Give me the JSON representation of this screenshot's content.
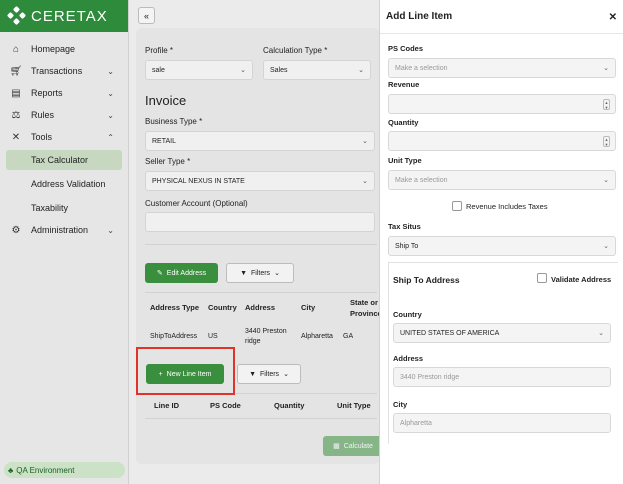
{
  "brand": {
    "name": "CERETAX"
  },
  "sidebar": {
    "items": [
      {
        "label": "Homepage"
      },
      {
        "label": "Transactions"
      },
      {
        "label": "Reports"
      },
      {
        "label": "Rules"
      },
      {
        "label": "Tools"
      },
      {
        "label": "Administration"
      }
    ],
    "tools_sub": [
      {
        "label": "Tax Calculator"
      },
      {
        "label": "Address Validation"
      },
      {
        "label": "Taxability"
      }
    ],
    "environment": "QA Environment"
  },
  "form": {
    "profile_label": "Profile *",
    "profile_value": "sale",
    "calc_type_label": "Calculation Type *",
    "calc_type_value": "Sales",
    "invoice_heading": "Invoice",
    "business_type_label": "Business Type *",
    "business_type_value": "RETAIL",
    "seller_type_label": "Seller Type *",
    "seller_type_value": "PHYSICAL NEXUS IN STATE",
    "customer_account_label": "Customer Account (Optional)",
    "edit_address_button": "Edit Address",
    "filters_button": "Filters",
    "new_line_item_button": "New Line Item",
    "calculate_button": "Calculate"
  },
  "address_table": {
    "headers": [
      "Address Type",
      "Country",
      "Address",
      "City",
      "State or Province"
    ],
    "row": [
      "ShipToAddress",
      "US",
      "3440 Preston ridge",
      "Alpharetta",
      "GA"
    ]
  },
  "line_table": {
    "headers": [
      "Line ID",
      "PS Code",
      "Quantity",
      "Unit Type"
    ]
  },
  "panel": {
    "title": "Add Line Item",
    "ps_codes_label": "PS Codes",
    "ps_codes_placeholder": "Make a selection",
    "revenue_label": "Revenue",
    "quantity_label": "Quantity",
    "unit_type_label": "Unit Type",
    "unit_type_placeholder": "Make a selection",
    "revenue_includes_taxes": "Revenue Includes Taxes",
    "tax_situs_label": "Tax Situs",
    "tax_situs_value": "Ship To",
    "ship_to_heading": "Ship To Address",
    "validate_address": "Validate Address",
    "country_label": "Country",
    "country_value": "UNITED STATES OF AMERICA",
    "address_label": "Address",
    "address_placeholder": "3440 Preston ridge",
    "city_label": "City",
    "city_placeholder": "Alpharetta"
  },
  "colors": {
    "brand_green": "#2e8b3c",
    "button_green": "#3a8f3e",
    "highlight_red": "#e0332a"
  }
}
